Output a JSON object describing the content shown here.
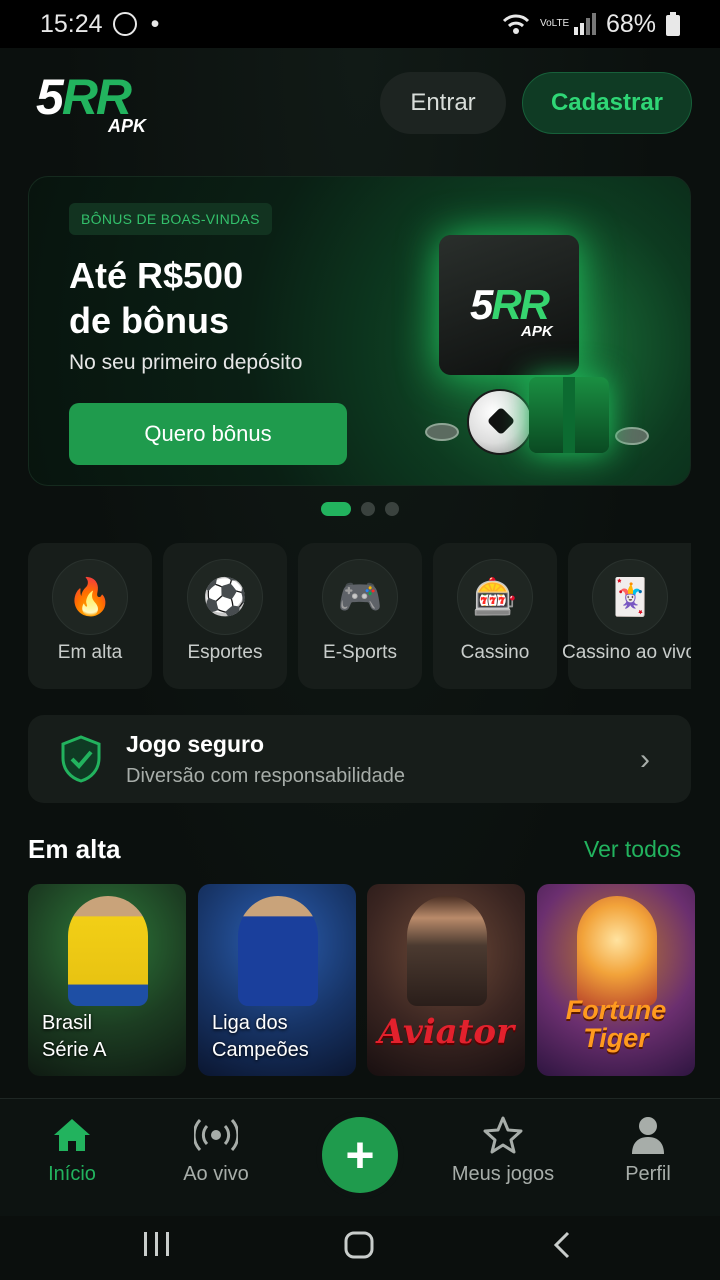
{
  "status": {
    "time": "15:24",
    "battery": "68%",
    "dot": "•",
    "volte": "VoLTE"
  },
  "header": {
    "logo_text": "5RR",
    "logo_sub": "APK",
    "login_label": "Entrar",
    "register_label": "Cadastrar"
  },
  "banner": {
    "badge": "BÔNUS DE BOAS-VINDAS",
    "title_line1": "Até R$500",
    "title_line2": "de bônus",
    "subtitle": "No seu primeiro depósito",
    "cta": "Quero bônus",
    "box_logo": "5RR",
    "box_sub": "APK"
  },
  "carousel": {
    "pages": 3,
    "active": 0
  },
  "categories": [
    {
      "label": "Em alta",
      "icon": "fire-icon",
      "glyph": "🔥"
    },
    {
      "label": "Esportes",
      "icon": "soccer-ball-icon",
      "glyph": "⚽"
    },
    {
      "label": "E-Sports",
      "icon": "gamepad-icon",
      "glyph": "🎮"
    },
    {
      "label": "Cassino",
      "icon": "slot-machine-icon",
      "glyph": "🎰"
    },
    {
      "label": "Cassino ao vivo",
      "icon": "playing-cards-icon",
      "glyph": "🃏"
    }
  ],
  "safe_play": {
    "title": "Jogo seguro",
    "subtitle": "Diversão com responsabilidade"
  },
  "trending": {
    "title": "Em alta",
    "see_all": "Ver todos",
    "games": [
      {
        "label_line1": "Brasil",
        "label_line2": "Série A"
      },
      {
        "label_line1": "Liga dos",
        "label_line2": "Campeões"
      },
      {
        "title": "Aviator"
      },
      {
        "title_line1": "Fortune",
        "title_line2": "Tiger"
      }
    ]
  },
  "bottom_nav": [
    {
      "label": "Início",
      "icon": "home-icon"
    },
    {
      "label": "Ao vivo",
      "icon": "live-broadcast-icon"
    },
    {
      "label": "Meus jogos",
      "icon": "star-icon"
    },
    {
      "label": "Perfil",
      "icon": "user-icon"
    }
  ],
  "fab": {
    "glyph": "+"
  },
  "colors": {
    "accent": "#22b35e",
    "background": "#0c1210",
    "card": "#171d1a"
  }
}
